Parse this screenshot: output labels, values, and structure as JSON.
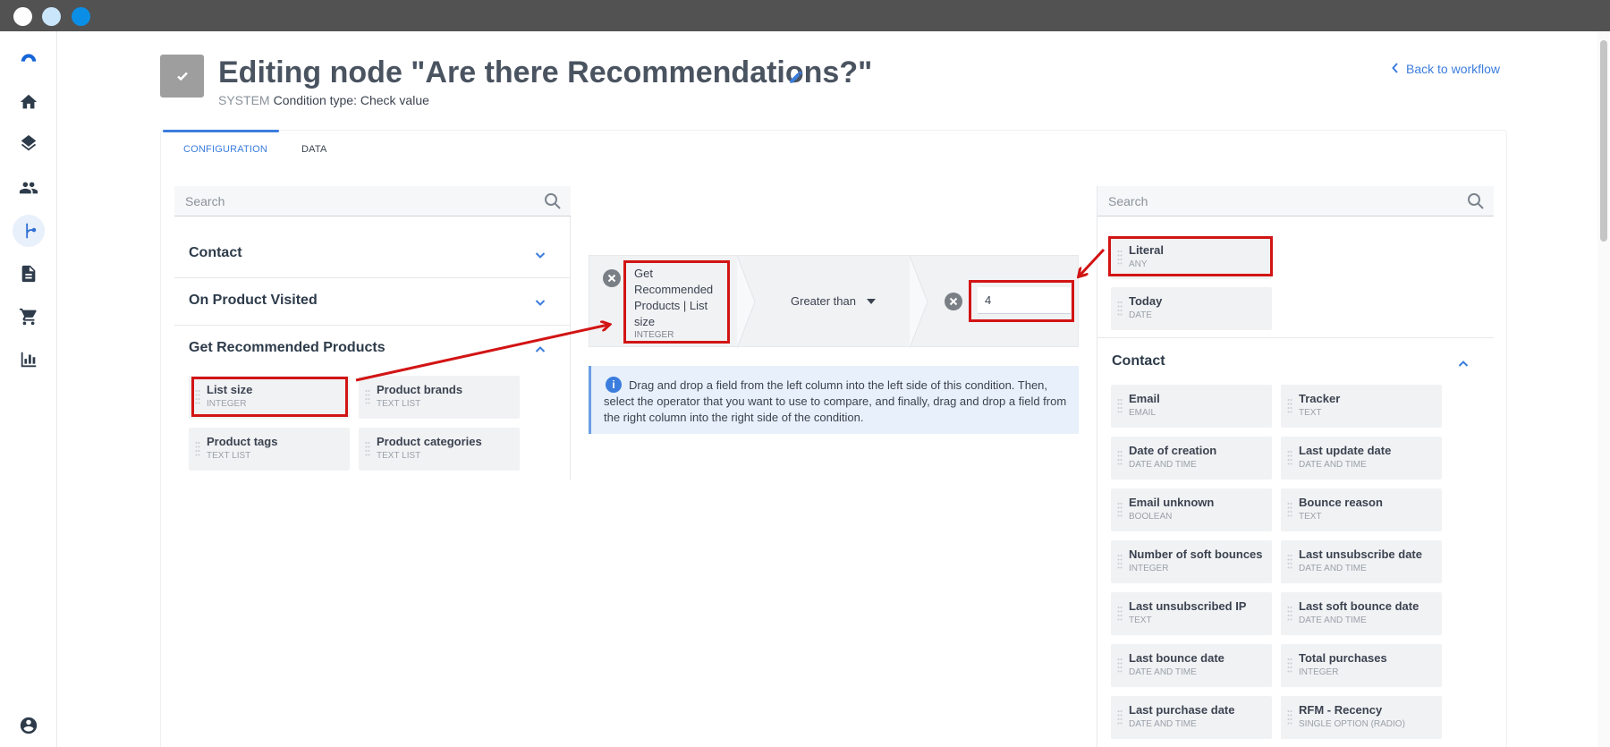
{
  "header": {
    "title": "Editing node \"Are there Recommendations?\"",
    "system_label": "SYSTEM",
    "condition_type": "Condition type: Check value",
    "back_link": "Back to workflow"
  },
  "sidebar": {
    "items": [
      {
        "icon": "logo-icon"
      },
      {
        "icon": "home-icon"
      },
      {
        "icon": "layers-icon"
      },
      {
        "icon": "people-icon"
      },
      {
        "icon": "workflow-icon",
        "active": true
      },
      {
        "icon": "document-icon"
      },
      {
        "icon": "cart-icon"
      },
      {
        "icon": "chart-icon"
      },
      {
        "icon": "account-icon"
      }
    ]
  },
  "tabs": {
    "configuration": "CONFIGURATION",
    "data": "DATA"
  },
  "left_panel": {
    "search_placeholder": "Search",
    "sections": [
      {
        "title": "Contact",
        "expanded": false
      },
      {
        "title": "On Product Visited",
        "expanded": false
      },
      {
        "title": "Get Recommended Products",
        "expanded": true
      }
    ],
    "fields": [
      {
        "name": "List size",
        "type": "INTEGER"
      },
      {
        "name": "Product brands",
        "type": "TEXT LIST"
      },
      {
        "name": "Product tags",
        "type": "TEXT LIST"
      },
      {
        "name": "Product categories",
        "type": "TEXT LIST"
      }
    ]
  },
  "condition": {
    "left_operand_name": "Get Recommended Products | List size",
    "left_operand_type": "INTEGER",
    "operator": "Greater than",
    "right_value": "4"
  },
  "info": {
    "text": "Drag and drop a field from the left column into the left side of this condition. Then, select the operator that you want to use to compare, and finally, drag and drop a field from the right column into the right side of the condition."
  },
  "right_panel": {
    "search_placeholder": "Search",
    "special_fields": [
      {
        "name": "Literal",
        "type": "ANY"
      },
      {
        "name": "Today",
        "type": "DATE"
      }
    ],
    "section_title": "Contact",
    "fields": [
      {
        "name": "Email",
        "type": "EMAIL"
      },
      {
        "name": "Tracker",
        "type": "TEXT"
      },
      {
        "name": "Date of creation",
        "type": "DATE AND TIME"
      },
      {
        "name": "Last update date",
        "type": "DATE AND TIME"
      },
      {
        "name": "Email unknown",
        "type": "BOOLEAN"
      },
      {
        "name": "Bounce reason",
        "type": "TEXT"
      },
      {
        "name": "Number of soft bounces",
        "type": "INTEGER"
      },
      {
        "name": "Last unsubscribe date",
        "type": "DATE AND TIME"
      },
      {
        "name": "Last unsubscribed IP",
        "type": "TEXT"
      },
      {
        "name": "Last soft bounce date",
        "type": "DATE AND TIME"
      },
      {
        "name": "Last bounce date",
        "type": "DATE AND TIME"
      },
      {
        "name": "Total purchases",
        "type": "INTEGER"
      },
      {
        "name": "Last purchase date",
        "type": "DATE AND TIME"
      },
      {
        "name": "RFM - Recency",
        "type": "SINGLE OPTION (RADIO)"
      }
    ]
  },
  "colors": {
    "accent": "#3b7ddd",
    "highlight": "#d21414",
    "field_bg": "#f1f2f4"
  }
}
